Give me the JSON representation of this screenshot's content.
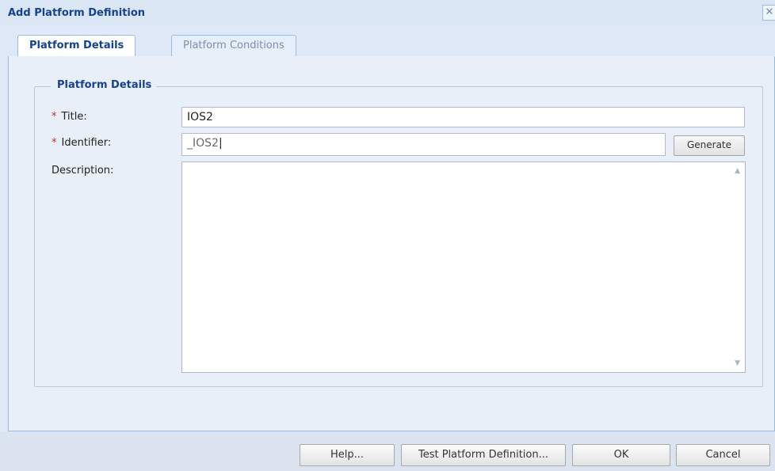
{
  "dialog": {
    "title": "Add Platform Definition",
    "close_icon": "close-icon"
  },
  "tabs": [
    {
      "label": "Platform Details",
      "active": true
    },
    {
      "label": "Platform Conditions",
      "active": false
    }
  ],
  "fieldset": {
    "legend": "Platform Details"
  },
  "form": {
    "required_marker": "*",
    "title_label": "Title:",
    "title_value": "IOS2",
    "identifier_label": "Identifier:",
    "identifier_value": "_IOS2",
    "generate_label": "Generate",
    "description_label": "Description:",
    "description_value": ""
  },
  "footer": {
    "help_label": "Help...",
    "test_label": "Test Platform Definition...",
    "ok_label": "OK",
    "cancel_label": "Cancel"
  },
  "colors": {
    "title_text": "#15428b",
    "required": "#d0302a",
    "panel_bg": "#e8eff9",
    "border": "#99bbe8"
  }
}
